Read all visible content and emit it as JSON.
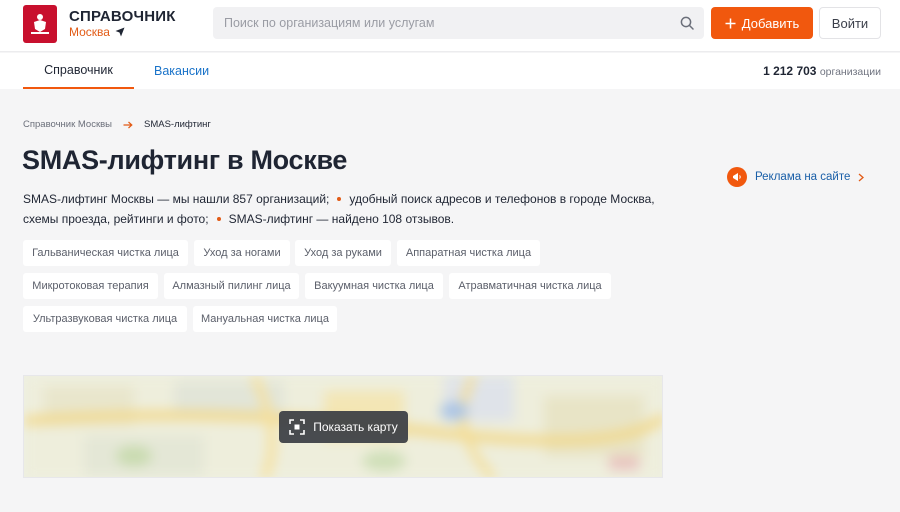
{
  "header": {
    "title": "СПРАВОЧНИК",
    "city": "Москва",
    "search_placeholder": "Поиск по организациям или услугам",
    "add_label": "Добавить",
    "login_label": "Войти"
  },
  "tabs": [
    {
      "label": "Справочник",
      "active": true
    },
    {
      "label": "Вакансии",
      "active": false
    }
  ],
  "org_count": {
    "value": "1 212 703",
    "label": "организации"
  },
  "breadcrumb": {
    "parent": "Справочник Москвы",
    "current": "SMAS-лифтинг"
  },
  "page": {
    "title": "SMAS-лифтинг в Москве",
    "desc_part1": "SMAS-лифтинг Москвы — мы нашли 857 организаций;",
    "desc_part2": "удобный поиск адресов и телефонов в городе Москва, схемы проезда, рейтинги и фото;",
    "desc_part3": "SMAS-лифтинг — найдено 108 отзывов."
  },
  "ad_link": "Реклама на сайте",
  "tags": [
    "Гальваническая чистка лица",
    "Уход за ногами",
    "Уход за руками",
    "Аппаратная чистка лица",
    "Микротоковая терапия",
    "Алмазный пилинг лица",
    "Вакуумная чистка лица",
    "Атравматичная чистка лица",
    "Ультразвуковая чистка лица",
    "Мануальная чистка лица"
  ],
  "map": {
    "show_label": "Показать карту"
  },
  "colors": {
    "accent": "#f1580e",
    "link": "#1a73c9",
    "brand_red": "#c8102e"
  }
}
